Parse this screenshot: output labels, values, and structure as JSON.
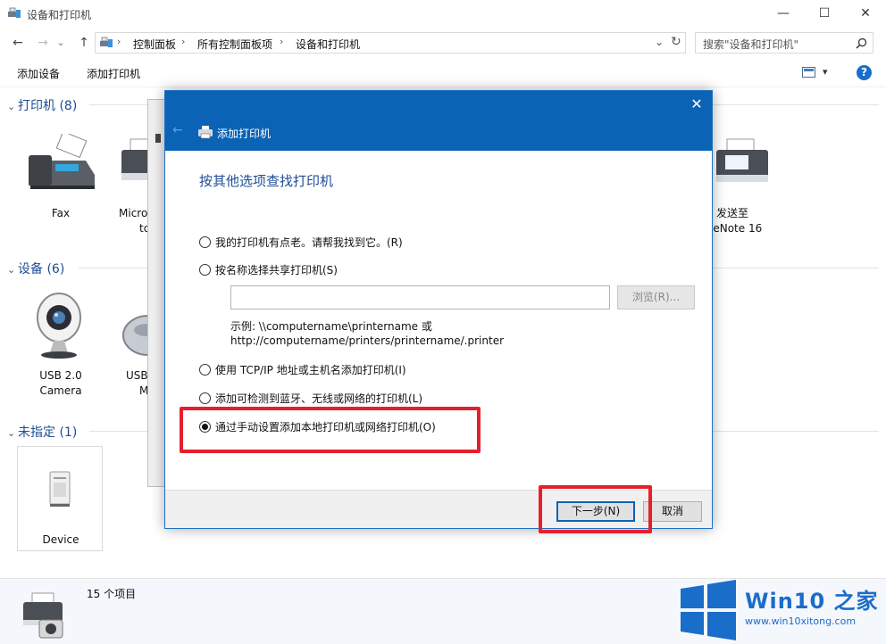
{
  "window": {
    "title": "设备和打印机",
    "minimize": "—",
    "maximize": "☐",
    "close": "✕"
  },
  "address": {
    "back": "←",
    "forward": "→",
    "dropdown": "⌄",
    "up": "↑",
    "crumbs": [
      "控制面板",
      "所有控制面板项",
      "设备和打印机"
    ],
    "sep": "›",
    "dropdown_right": "⌄",
    "refresh": "↻",
    "search_placeholder": "搜索\"设备和打印机\""
  },
  "toolbar": {
    "add_device": "添加设备",
    "add_printer": "添加打印机",
    "view_dropdown": "▾",
    "help": "?"
  },
  "groups": {
    "printers": {
      "header": "打印机 (8)",
      "items": [
        {
          "label": "Fax"
        },
        {
          "label": "Micro",
          "label2": "to"
        },
        {
          "label": "发送至",
          "label2": "neNote 16"
        }
      ]
    },
    "devices": {
      "header": "设备 (6)",
      "items": [
        {
          "label": "USB 2.0",
          "label2": "Camera"
        },
        {
          "label": "USB",
          "label2": "M"
        }
      ]
    },
    "unspecified": {
      "header": "未指定 (1)",
      "items": [
        {
          "label": "Device"
        }
      ]
    },
    "chevron": "⌄"
  },
  "status": {
    "count": "15 个项目"
  },
  "dialog": {
    "title": "添加打印机",
    "back": "←",
    "close": "✕",
    "heading": "按其他选项查找打印机",
    "options": [
      {
        "label": "我的打印机有点老。请帮我找到它。(R)",
        "selected": false
      },
      {
        "label": "按名称选择共享打印机(S)",
        "selected": false
      },
      {
        "label": "使用 TCP/IP 地址或主机名添加打印机(I)",
        "selected": false
      },
      {
        "label": "添加可检测到蓝牙、无线或网络的打印机(L)",
        "selected": false
      },
      {
        "label": "通过手动设置添加本地打印机或网络打印机(O)",
        "selected": true
      }
    ],
    "share_input_value": "",
    "browse_label": "浏览(R)...",
    "example_line1": "示例: \\\\computername\\printername 或",
    "example_line2": "http://computername/printers/printername/.printer",
    "next_label": "下一步(N)",
    "cancel_label": "取消"
  },
  "watermark": {
    "brand": "Win10 之家",
    "site": "www.win10xitong.com"
  },
  "colors": {
    "accent": "#0a63b5",
    "group_header": "#1e4c96",
    "highlight": "#e5202b"
  }
}
